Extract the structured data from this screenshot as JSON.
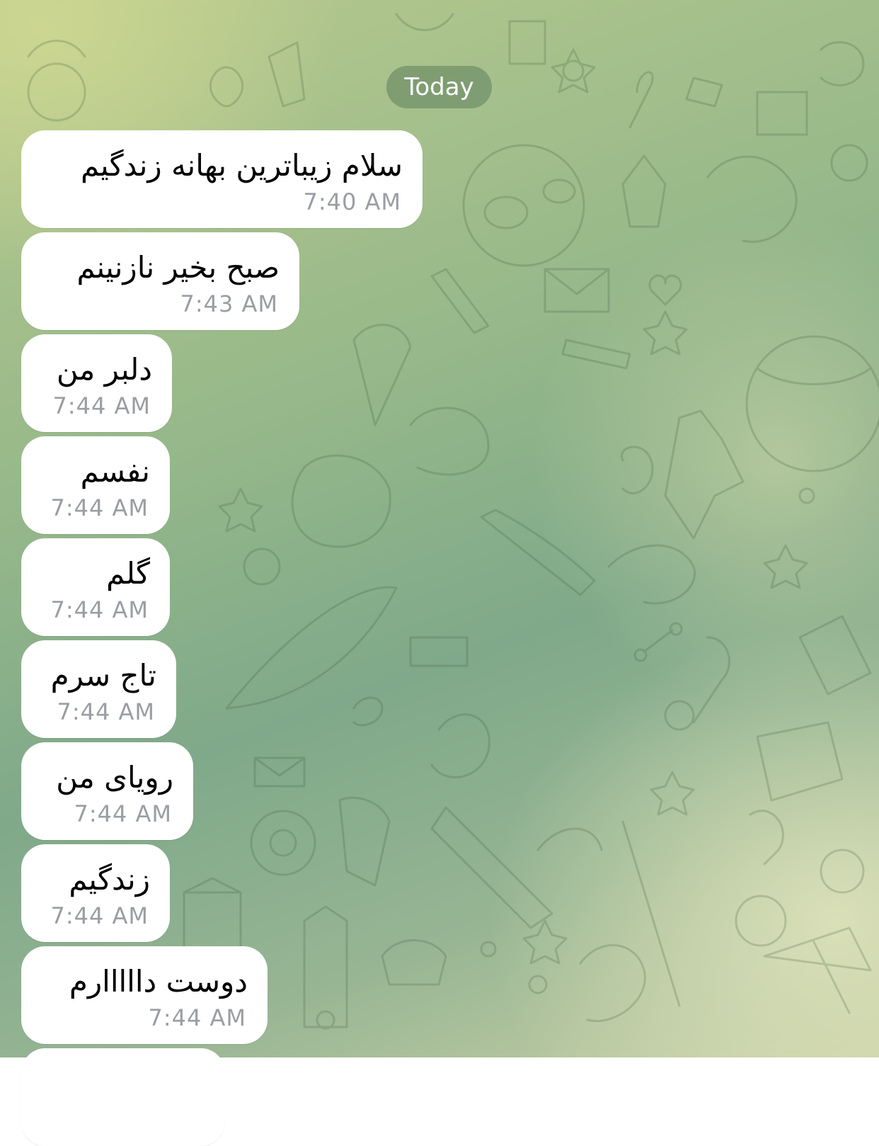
{
  "date_separator": "Today",
  "messages": [
    {
      "text": "سلام زیباترین بهانه زندگیم",
      "time": "7:40 AM"
    },
    {
      "text": "صبح بخیر نازنینم",
      "time": "7:43 AM"
    },
    {
      "text": "دلبر من",
      "time": "7:44 AM"
    },
    {
      "text": "نفسم",
      "time": "7:44 AM"
    },
    {
      "text": "گلم",
      "time": "7:44 AM"
    },
    {
      "text": "تاج سرم",
      "time": "7:44 AM"
    },
    {
      "text": "رویای من",
      "time": "7:44 AM"
    },
    {
      "text": "زندگیم",
      "time": "7:44 AM"
    },
    {
      "text": "دوست دااااارم",
      "time": "7:44 AM"
    }
  ],
  "colors": {
    "bubble": "#ffffff",
    "timestamp": "#9a9ea3",
    "date_pill": "#5e805c"
  }
}
